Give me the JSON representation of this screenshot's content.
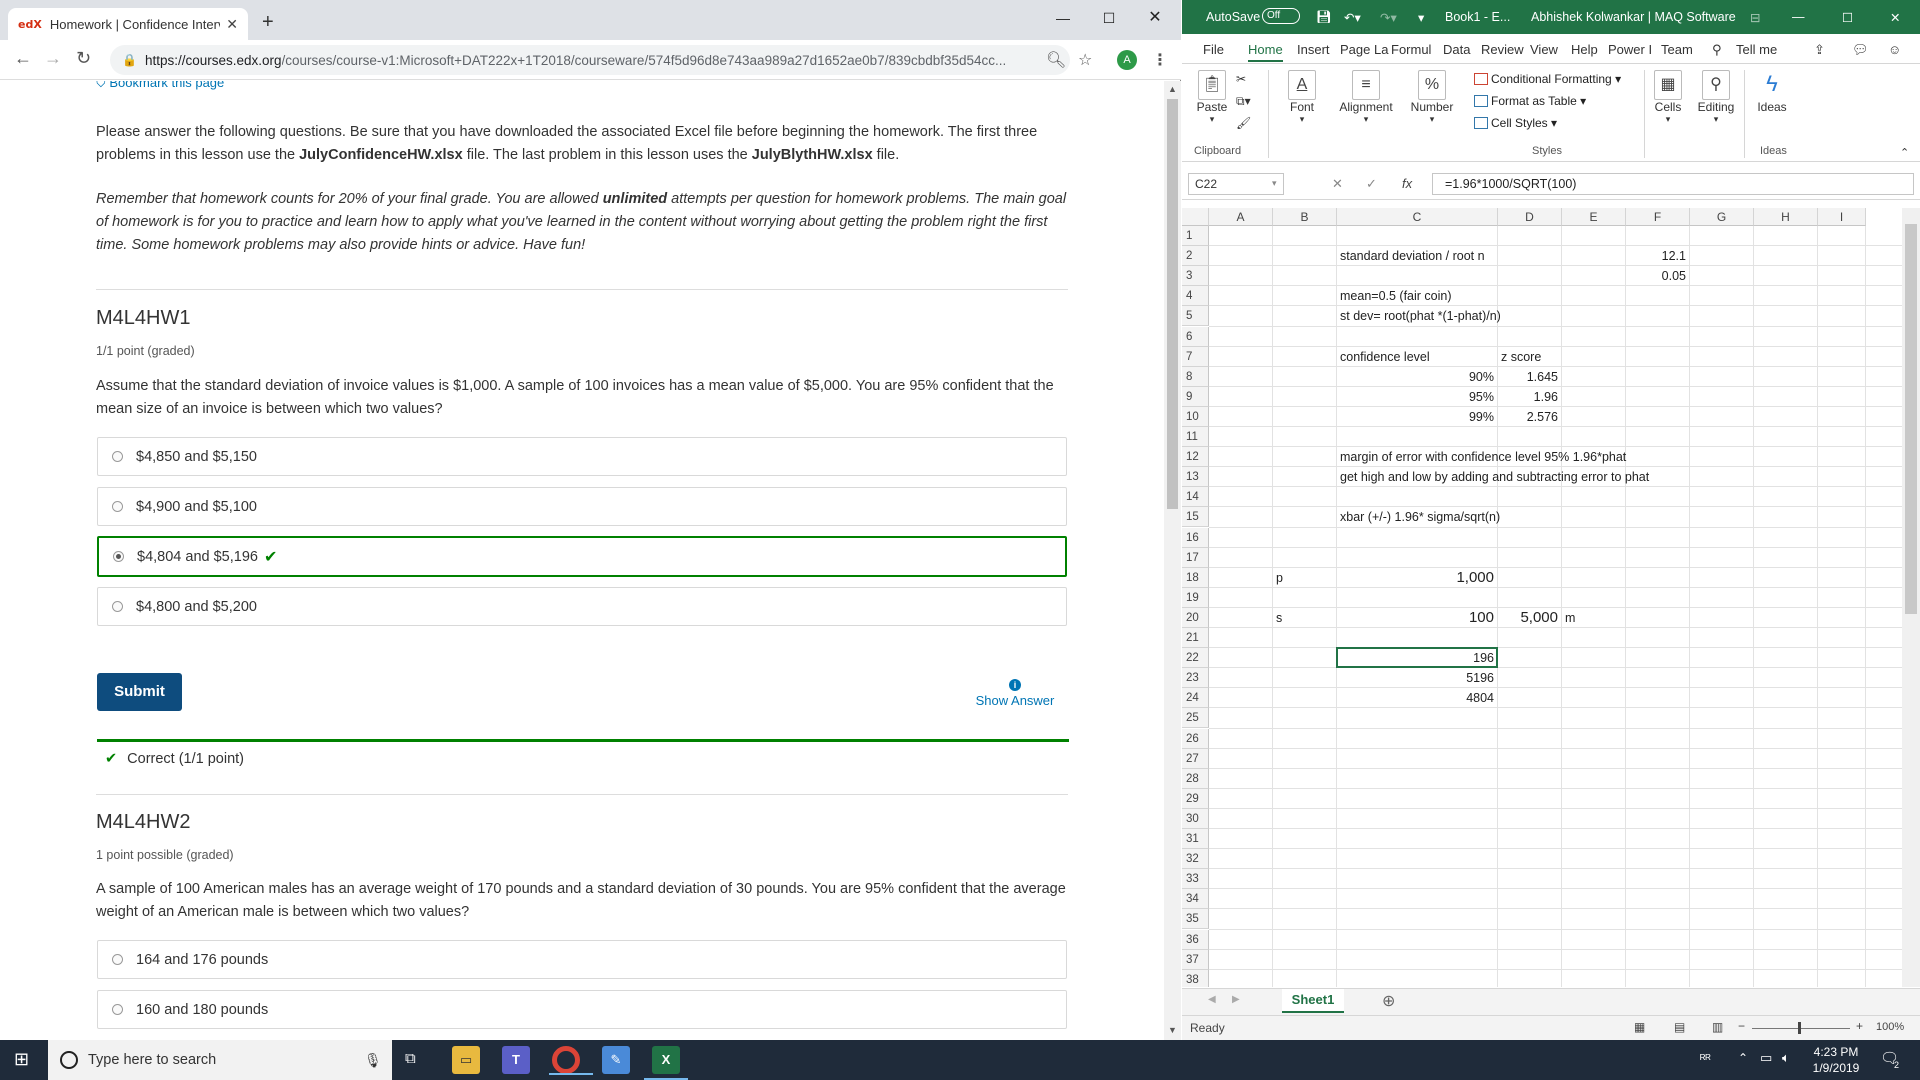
{
  "chrome": {
    "tab_title": "Homework | Confidence Interval",
    "tab_favicon": "edX",
    "url_host": "https://courses.edx.org",
    "url_path": "/courses/course-v1:Microsoft+DAT222x+1T2018/courseware/574f5d96d8e743aa989a27d1652ae0b7/839cbdbf35d54cc...",
    "avatar_letter": "A"
  },
  "page": {
    "bookmark": "Bookmark this page",
    "intro_1": "Please answer the following questions. Be sure that you have downloaded the associated Excel file before beginning the homework. The first three problems in this lesson use the ",
    "intro_file1": "JulyConfidenceHW.xlsx",
    "intro_2": " file. The last problem in this lesson uses the ",
    "intro_file2": "JulyBlythHW.xlsx",
    "intro_3": " file.",
    "note_1": "Remember that homework counts for 20% of your final grade. You are allowed ",
    "note_bold": "unlimited",
    "note_2": " attempts per question for homework problems. The main goal of homework is for you to practice and learn how to apply what you've learned in the content without worrying about getting the problem right the first time. Some homework problems may also provide hints or advice. Have fun!",
    "q1": {
      "heading": "M4L4HW1",
      "points": "1/1 point (graded)",
      "text": "Assume that the standard deviation of invoice values is $1,000. A sample of 100 invoices has a mean value of $5,000. You are 95% confident that the mean size of an invoice is between which two values?",
      "options": [
        "$4,850 and $5,150",
        "$4,900 and $5,100",
        "$4,804 and $5,196",
        "$4,800 and $5,200"
      ],
      "selected_index": 2,
      "submit": "Submit",
      "show_answer": "Show Answer",
      "result": "Correct (1/1 point)"
    },
    "q2": {
      "heading": "M4L4HW2",
      "points": "1 point possible (graded)",
      "text": "A sample of 100 American males has an average weight of 170 pounds and a standard deviation of 30 pounds. You are 95% confident that the average weight of an American male is between which two values?",
      "options": [
        "164 and 176 pounds",
        "160 and 180 pounds"
      ]
    }
  },
  "excel": {
    "autosave": "AutoSave",
    "autosave_state": "Off",
    "doc_title": "Book1 - E...",
    "user": "Abhishek Kolwankar | MAQ Software",
    "menu": [
      "File",
      "Home",
      "Insert",
      "Page La",
      "Formul",
      "Data",
      "Review",
      "View",
      "Help",
      "Power I",
      "Team",
      "Tell me"
    ],
    "ribbon": {
      "paste": "Paste",
      "font": "Font",
      "alignment": "Alignment",
      "number": "Number",
      "cond_format": "Conditional Formatting",
      "format_table": "Format as Table",
      "cell_styles": "Cell Styles",
      "cells": "Cells",
      "editing": "Editing",
      "ideas": "Ideas",
      "group_clipboard": "Clipboard",
      "group_styles": "Styles",
      "group_ideas": "Ideas"
    },
    "name_box": "C22",
    "formula": "=1.96*1000/SQRT(100)",
    "columns": [
      "A",
      "B",
      "C",
      "D",
      "E",
      "F",
      "G",
      "H",
      "I"
    ],
    "rows": [
      "1",
      "2",
      "3",
      "4",
      "5",
      "6",
      "7",
      "8",
      "9",
      "10",
      "11",
      "12",
      "13",
      "14",
      "15",
      "16",
      "17",
      "18",
      "19",
      "20",
      "21",
      "22",
      "23",
      "24",
      "25",
      "26",
      "27",
      "28",
      "29",
      "30",
      "31",
      "32",
      "33",
      "34",
      "35",
      "36",
      "37",
      "38"
    ],
    "cells": {
      "C2": "standard deviation / root n",
      "F2": "12.1",
      "F3": "0.05",
      "C4": "mean=0.5 (fair coin)",
      "C5": "st dev= root(phat *(1-phat)/n)",
      "C7": "confidence level",
      "D7": "z score",
      "C8": "90%",
      "D8": "1.645",
      "C9": "95%",
      "D9": "1.96",
      "C10": "99%",
      "D10": "2.576",
      "C12": "margin of error with confidence level 95% 1.96*phat",
      "C13": "get high and low by adding and subtracting error to phat",
      "C15": "xbar (+/-) 1.96* sigma/sqrt(n)",
      "B18": "p",
      "C18": "1,000",
      "B20": "s",
      "C20": "100",
      "D20": "5,000",
      "E20": "m",
      "C22": "196",
      "C23": "5196",
      "C24": "4804"
    },
    "sheet_tab": "Sheet1",
    "status": "Ready",
    "zoom": "100%"
  },
  "taskbar": {
    "search_placeholder": "Type here to search",
    "time": "4:23 PM",
    "date": "1/9/2019",
    "notif_count": "2"
  }
}
